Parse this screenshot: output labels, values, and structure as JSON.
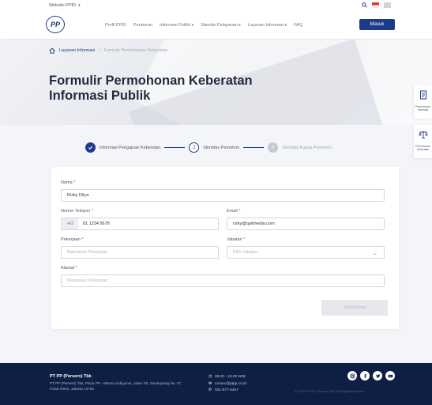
{
  "topbar": {
    "site_switch": "Website PPID"
  },
  "header": {
    "logo_text": "PP",
    "nav": [
      "Profil PPID",
      "Peraturan",
      "Informasi Publik",
      "Standar Pelayanan",
      "Layanan Informasi",
      "FAQ"
    ],
    "login_label": "Masuk"
  },
  "breadcrumb": {
    "item1": "Layanan Informasi",
    "item2": "Formulir Permohonan Keberatan"
  },
  "hero": {
    "title": "Formulir Permohonan Keberatan Informasi Publik"
  },
  "float_panel": [
    {
      "label": "Permohonan Informasi"
    },
    {
      "label": "Permohonan Keberatan"
    }
  ],
  "stepper": {
    "steps": [
      {
        "number": "",
        "label": "Informasi Pengajuan Keberatan",
        "state": "done"
      },
      {
        "number": "2",
        "label": "Identitas Pemohon",
        "state": "current"
      },
      {
        "number": "3",
        "label": "Identitas Kuasa Pemohon",
        "state": "upcoming"
      }
    ]
  },
  "form": {
    "nama": {
      "label": "Nama",
      "value": "Rizky Ditya"
    },
    "telepon": {
      "label": "Nomor Telepon",
      "prefix": "+62",
      "value": "81 1234 5678"
    },
    "email": {
      "label": "Email",
      "value": "rizky@quitmedia.com"
    },
    "pekerjaan": {
      "label": "Pekerjaan",
      "placeholder": "Masukkan Pekerjaan"
    },
    "jabatan": {
      "label": "Jabatan",
      "placeholder": "Pilih Jabatan"
    },
    "alamat": {
      "label": "Alamat",
      "placeholder": "Masukkan Pekerjaan"
    },
    "next_label": "Selanjutnya",
    "required_mark": "*"
  },
  "footer": {
    "company": "PT PP (Persero) Tbk",
    "address": "PT PP (Persero) Tbk, Plaza PP - Wisma Subiyanto, Jalan TB. Simatupang No. 57, Pasar Rebo, Jakarta 13760",
    "hours": "08.00 - 16.00 WIB",
    "email": "corsec@ptpp.co.id",
    "phone": "021-877-8467",
    "copyright": "© 2023 PT PP (Persero) Tbk. All Rights Reserved."
  },
  "colors": {
    "primary": "#1c3b8a",
    "footer_bg": "#0f1f44",
    "required": "#d9363e"
  }
}
